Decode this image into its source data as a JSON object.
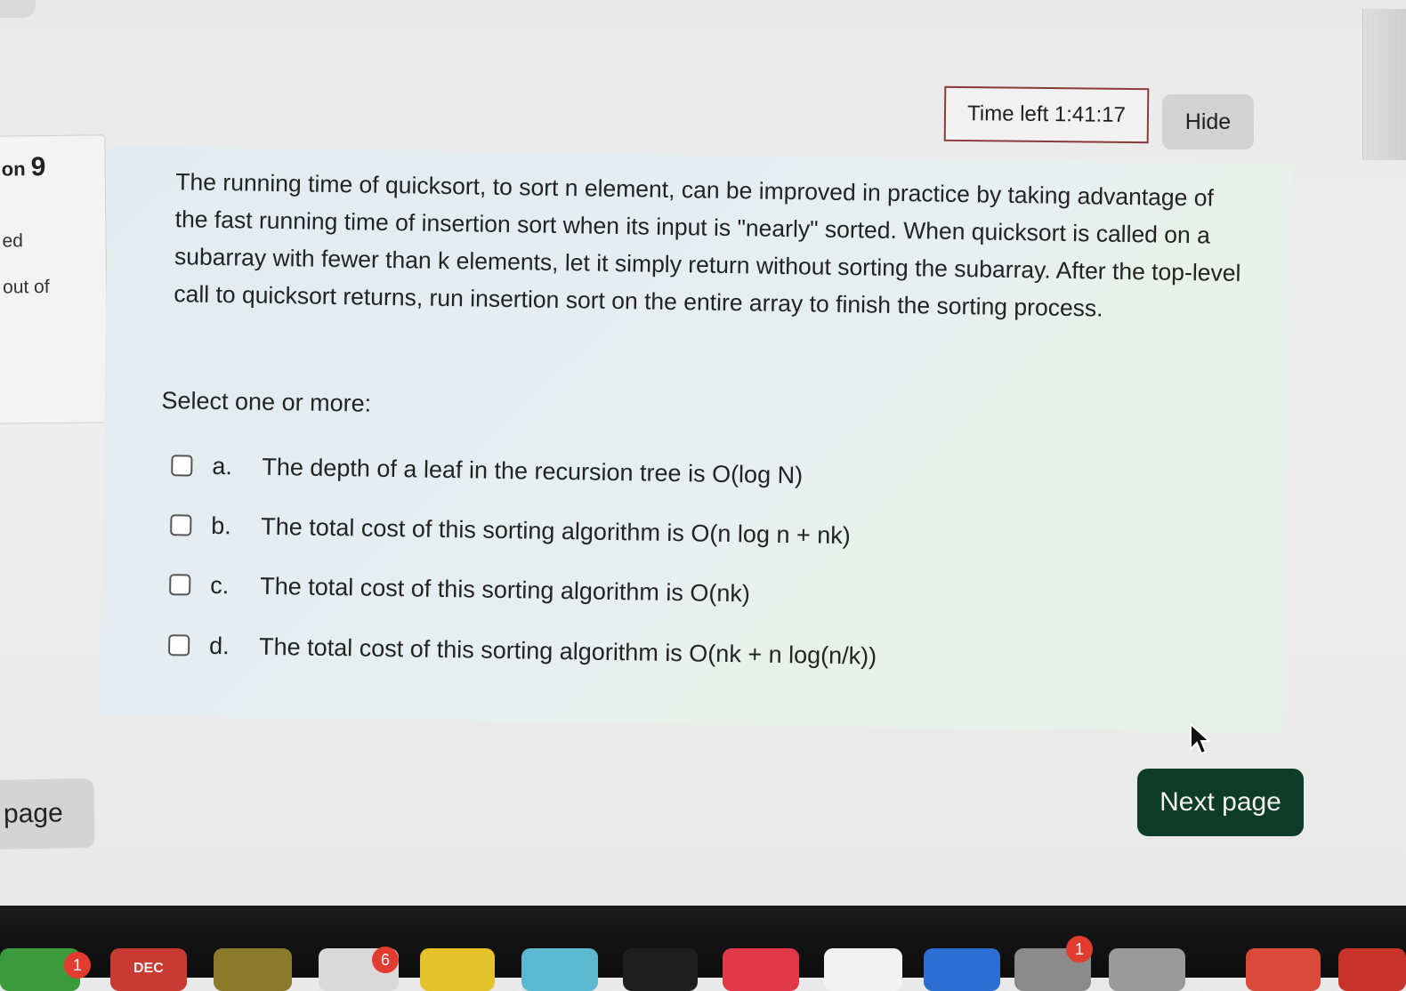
{
  "sidebar": {
    "question_prefix": "on",
    "question_number": "9",
    "status": "ed",
    "marks": "out of"
  },
  "timer": {
    "text": "Time left 1:41:17",
    "hide_label": "Hide"
  },
  "question": {
    "text": "The running time of quicksort, to sort n element, can be improved in practice by taking advantage of the fast running time of insertion sort when its input is \"nearly\" sorted. When quicksort is called on a subarray with fewer than k elements, let it simply return without sorting the subarray. After the top-level call to quicksort returns, run insertion sort on the entire array to finish the sorting process.",
    "prompt": "Select one or more:",
    "options": [
      {
        "letter": "a.",
        "text": "The depth of a leaf in the recursion tree is O(log N)"
      },
      {
        "letter": "b.",
        "text": "The total cost of this sorting algorithm is O(n log n + nk)"
      },
      {
        "letter": "c.",
        "text": "The total cost of this sorting algorithm is O(nk)"
      },
      {
        "letter": "d.",
        "text": "The total cost of this sorting algorithm is O(nk + n log(n/k))"
      }
    ]
  },
  "navigation": {
    "previous_label": "page",
    "next_label": "Next page"
  },
  "dock": {
    "badges": [
      "1",
      "6",
      "1"
    ],
    "calendar_month": "DEC"
  },
  "colors": {
    "next_button": "#0e3b2a",
    "timer_border": "#8b3a3a",
    "badge": "#e23b2f"
  }
}
